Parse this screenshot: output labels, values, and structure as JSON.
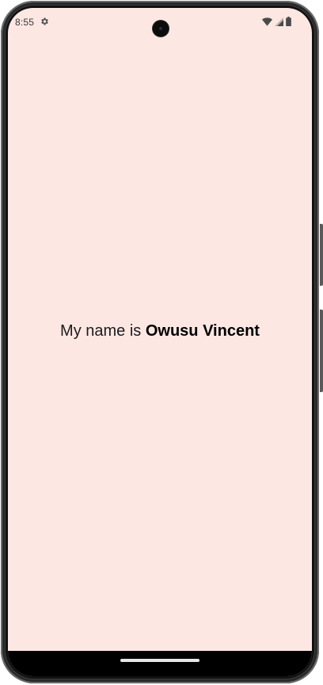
{
  "status_bar": {
    "time": "8:55",
    "left_icons": [
      "gear-icon"
    ],
    "right_icons": [
      "wifi-icon",
      "signal-icon",
      "battery-icon"
    ]
  },
  "content": {
    "prefix": "My name is ",
    "name": "Owusu Vincent"
  },
  "colors": {
    "background": "#FDE7E3",
    "text": "#1C1C1C",
    "nav_bar": "#000000",
    "bezel": "#3B3B3B"
  }
}
